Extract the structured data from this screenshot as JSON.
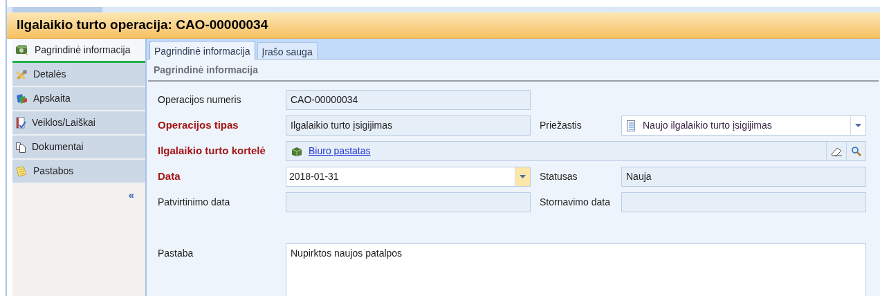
{
  "window": {
    "title": "Ilgalaikio turto operacija: CAO-00000034"
  },
  "sidebar": {
    "items": [
      {
        "label": "Pagrindinė informacija",
        "selected": true
      },
      {
        "label": "Detalės",
        "selected": false
      },
      {
        "label": "Apskaita",
        "selected": false
      },
      {
        "label": "Veiklos/Laiškai",
        "selected": false
      },
      {
        "label": "Dokumentai",
        "selected": false
      },
      {
        "label": "Pastabos",
        "selected": false
      }
    ],
    "collapse": "«"
  },
  "tabs": [
    {
      "label": "Pagrindinė informacija",
      "selected": true
    },
    {
      "label": "Įrašo sauga",
      "selected": false
    }
  ],
  "section": {
    "title": "Pagrindinė informacija"
  },
  "form": {
    "rows": [
      {
        "fields": [
          {
            "label": "Operacijos numeris",
            "required": false,
            "kind": "text",
            "readonly": true,
            "value": "CAO-00000034"
          }
        ]
      },
      {
        "fields": [
          {
            "label": "Operacijos tipas",
            "required": true,
            "kind": "text",
            "readonly": true,
            "value": "Ilgalaikio turto įsigijimas"
          },
          {
            "label": "Priežastis",
            "required": false,
            "kind": "combo",
            "readonly": false,
            "value": "Naujo ilgalaikio turto įsigijimas"
          }
        ]
      },
      {
        "fields": [
          {
            "label": "Ilgalaikio turto kortelė",
            "required": true,
            "kind": "lookup",
            "readonly": true,
            "value": "Biuro pastatas"
          }
        ]
      },
      {
        "fields": [
          {
            "label": "Data",
            "required": true,
            "kind": "date",
            "readonly": false,
            "value": "2018-01-31"
          },
          {
            "label": "Statusas",
            "required": false,
            "kind": "text",
            "readonly": true,
            "value": "Nauja"
          }
        ]
      },
      {
        "fields": [
          {
            "label": "Patvirtinimo data",
            "required": false,
            "kind": "text",
            "readonly": true
          },
          {
            "label": "Stornavimo data",
            "required": false,
            "kind": "text",
            "readonly": true
          }
        ]
      }
    ],
    "note": {
      "label": "Pastaba",
      "required": false,
      "kind": "memo",
      "readonly": false,
      "value": "Nupirktos naujos patalpos"
    }
  }
}
